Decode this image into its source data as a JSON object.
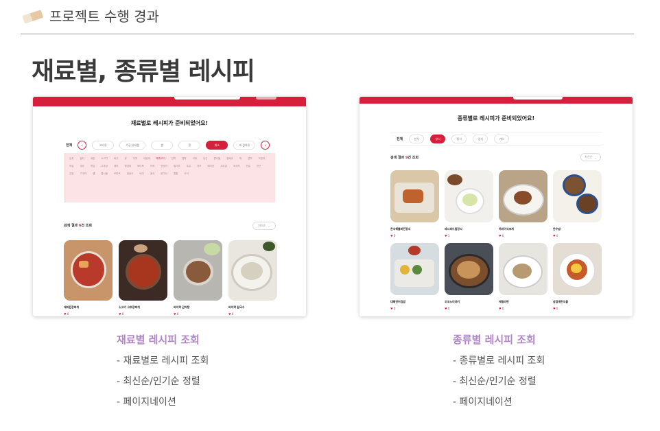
{
  "header": {
    "title": "프로젝트 수행 경과"
  },
  "main_title": "재료별, 종류별 레시피",
  "card1": {
    "heading": "재료별로 레시피가 준비되었어요!",
    "filter_label": "전체",
    "chips": [
      "고기류",
      "가공,유제품",
      "쌀",
      "콩",
      "채소",
      "과.견과류"
    ],
    "tags": [
      "김치",
      "참치",
      "계란",
      "소고기",
      "버섯",
      "닭",
      "두부",
      "애호박",
      "돼지고기",
      "감자",
      "양파",
      "어묵",
      "당근",
      "콩나물",
      "양배추",
      "떡",
      "감자",
      "오징어",
      "마늘",
      "새우",
      "깻잎",
      "고추장",
      "대파",
      "청경채",
      "토마토",
      "카레",
      "양송이",
      "밀가루",
      "우유",
      "치즈",
      "베이컨",
      "새우살",
      "소세지",
      "전분",
      "연근",
      "간장",
      "고구마",
      "햄",
      "콩나물",
      "토마토",
      "양상추",
      "버섯",
      "꽃게",
      "닭다리",
      "홍합",
      "오이"
    ],
    "result_prefix": "검색 결과",
    "result_count": "6",
    "result_suffix": "건 조회",
    "sort": "최신순",
    "items": [
      {
        "name": "대파된장찌개",
        "likes": "0"
      },
      {
        "name": "소고기 고추장찌개",
        "likes": "0"
      },
      {
        "name": "바지락 감자탕",
        "likes": "0"
      },
      {
        "name": "바지락 칼국수",
        "likes": "0"
      }
    ]
  },
  "card2": {
    "heading": "종류별로 레시피가 준비되었어요!",
    "filter_label": "전체",
    "chips": [
      "한식",
      "양식",
      "중식",
      "일식",
      "기타"
    ],
    "result_prefix": "검색 결과",
    "result_count": "9",
    "result_suffix": "건 조회",
    "sort": "최신순",
    "items": [
      {
        "name": "한식해물파전정식",
        "likes": "0"
      },
      {
        "name": "레시피드림정식",
        "likes": "1"
      },
      {
        "name": "하와이식포케",
        "likes": "0"
      },
      {
        "name": "한우밥",
        "likes": "0"
      },
      {
        "name": "대패연어김밥",
        "likes": "0"
      },
      {
        "name": "오코노미야키",
        "likes": "0"
      },
      {
        "name": "에밀라면",
        "likes": "0"
      },
      {
        "name": "삼겹계란오믈",
        "likes": "0"
      }
    ]
  },
  "section1": {
    "heading": "재료별 레시피 조회",
    "items": [
      "- 재료별로 레시피 조회",
      "- 최신순/인기순 정렬",
      "- 페이지네이션"
    ]
  },
  "section2": {
    "heading": "종류별 레시피 조회",
    "items": [
      "- 종류별로 레시피 조회",
      "- 최신순/인기순 정렬",
      "- 페이지네이션"
    ]
  },
  "colors": {
    "accent": "#d61f3b",
    "highlight": "#c9b8e8",
    "section_heading": "#b085c4",
    "tag_bg": "#fbe3e6"
  }
}
